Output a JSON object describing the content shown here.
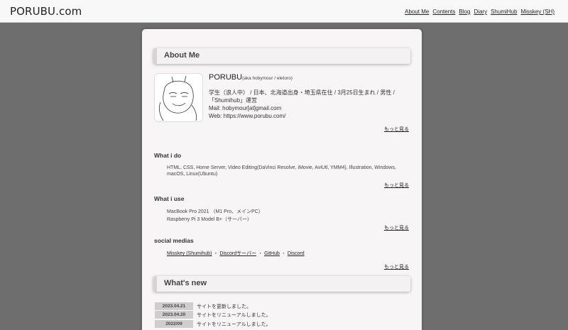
{
  "header": {
    "site_title": "PORUBU.com",
    "nav": [
      "About Me",
      "Contents",
      "Blog",
      "Diary",
      "ShumiHub",
      "Misskey (SH)"
    ]
  },
  "about": {
    "heading": "About Me",
    "name": "PORUBU",
    "aka": "(aka hobymour / eletoro)",
    "bio_line1": "学生（浪人中） / 日本、北海道出身・埼玉県在住 / 3月25日生まれ / 男性 / 「Shumihub」運営",
    "mail": "Mail: hobymour[at]gmail.com",
    "web": "Web: https://www.porubu.com/",
    "more": "もっと見る"
  },
  "what_i_do": {
    "heading": "What i do",
    "text": "HTML, CSS, Home Server, Video Editing(DaVinci Resolve, iMovie, AviUtl, YMM4), Illustration, Windows, macOS, Linux(Ubuntu)",
    "more": "もっと見る"
  },
  "what_i_use": {
    "heading": "What i use",
    "line1": "MacBook Pro 2021 （M1 Pro、メインPC）",
    "line2": "Raspberry Pi 3 Model B+（サーバー）",
    "more": "もっと見る"
  },
  "social": {
    "heading": "social medias",
    "links": [
      "Misskey (Shumihub)",
      "Discordサーバー",
      "GitHub",
      "Discord"
    ],
    "separator": "・",
    "more": "もっと見る"
  },
  "whats_new": {
    "heading": "What's new",
    "items": [
      {
        "date": "2023.04.21",
        "text": "サイトを更新しました。"
      },
      {
        "date": "2023.04.20",
        "text": "サイトをリニューアルしました。"
      },
      {
        "date": "2022/09",
        "text": "サイトをリニューアルしました。"
      }
    ]
  }
}
